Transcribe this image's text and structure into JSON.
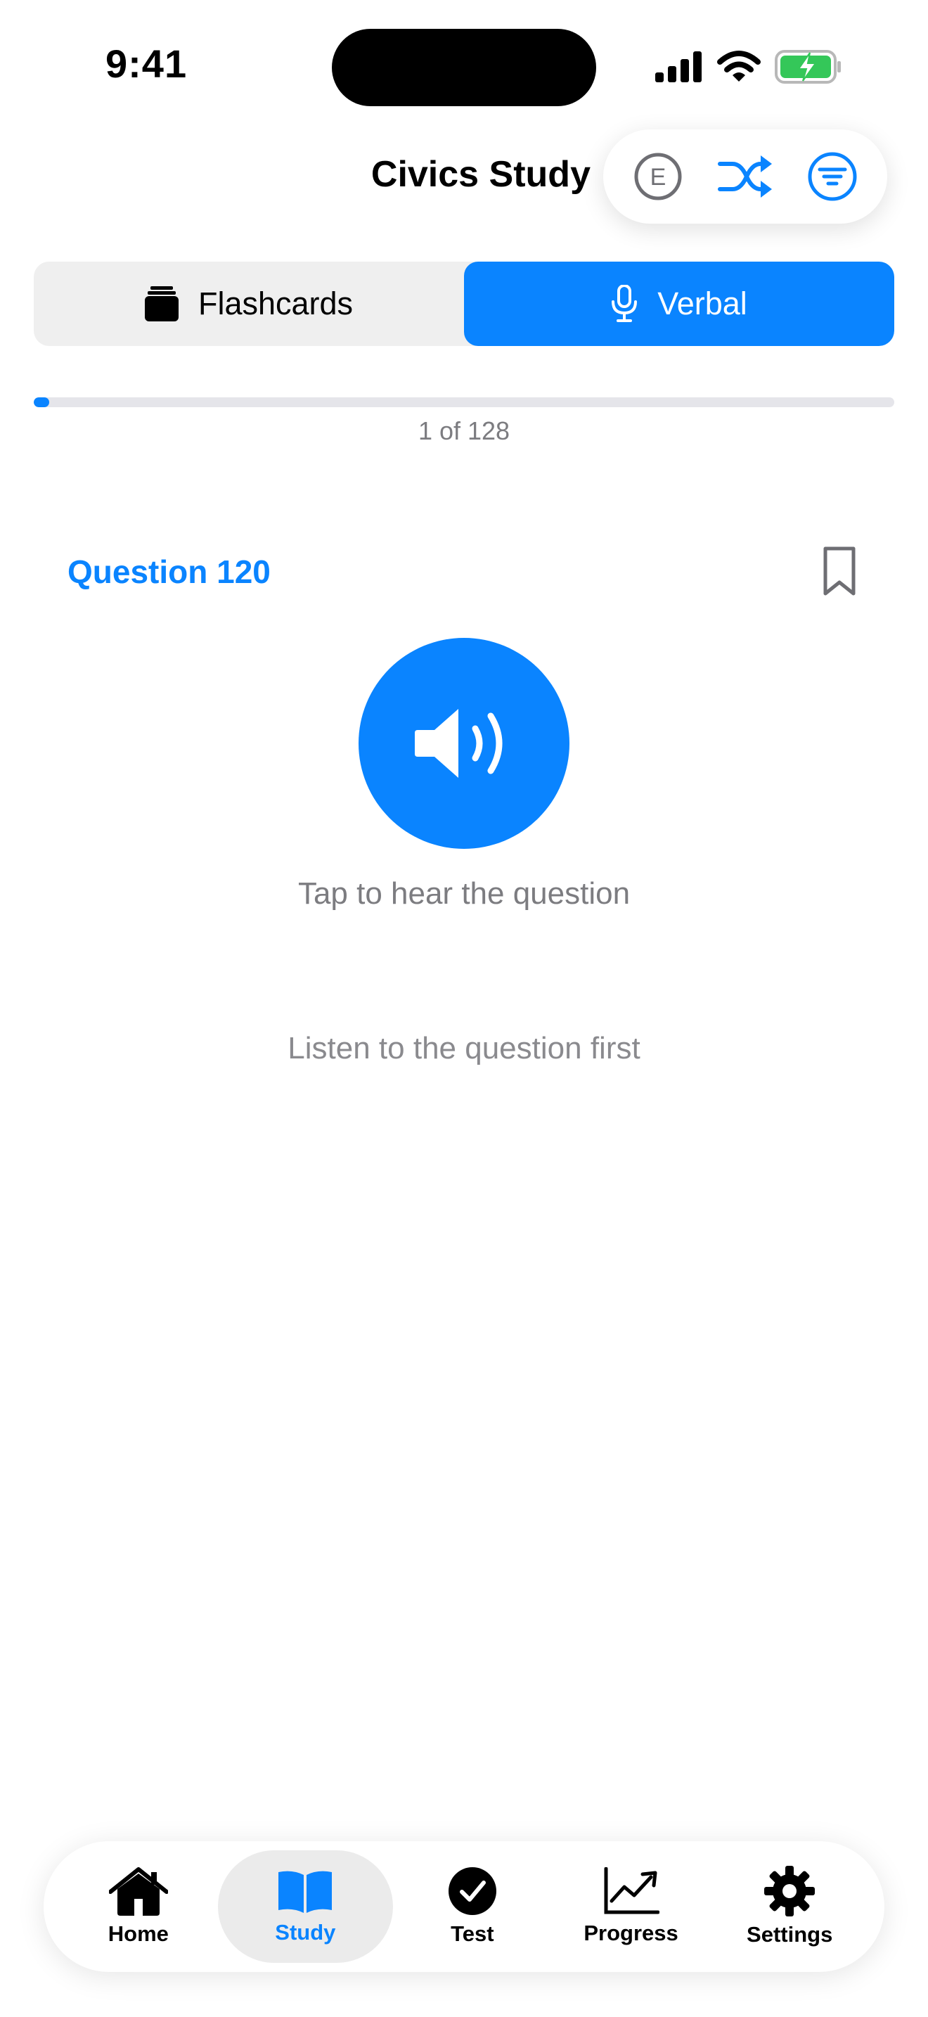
{
  "status_bar": {
    "time": "9:41"
  },
  "header": {
    "title": "Civics Study"
  },
  "toolbar": {
    "buttons": [
      {
        "name": "language-english-icon",
        "glyph": "E"
      },
      {
        "name": "shuffle-icon"
      },
      {
        "name": "filter-icon"
      }
    ]
  },
  "mode_tabs": [
    {
      "label": "Flashcards",
      "icon": "stack-icon",
      "selected": false
    },
    {
      "label": "Verbal",
      "icon": "microphone-icon",
      "selected": true
    }
  ],
  "progress": {
    "current": 1,
    "total": 128,
    "label": "1 of 128",
    "fraction": 0.0078
  },
  "question": {
    "label": "Question 120",
    "tap_hint": "Tap to hear the question",
    "listen_hint": "Listen to the question first"
  },
  "tab_bar": {
    "items": [
      {
        "label": "Home",
        "icon": "house-icon",
        "selected": false
      },
      {
        "label": "Study",
        "icon": "book-icon",
        "selected": true
      },
      {
        "label": "Test",
        "icon": "checkmark-circle-icon",
        "selected": false
      },
      {
        "label": "Progress",
        "icon": "chart-line-icon",
        "selected": false
      },
      {
        "label": "Settings",
        "icon": "gear-icon",
        "selected": false
      }
    ]
  },
  "colors": {
    "accent": "#0a84ff",
    "secondary_text": "#7c7c80",
    "battery": "#34c759"
  }
}
